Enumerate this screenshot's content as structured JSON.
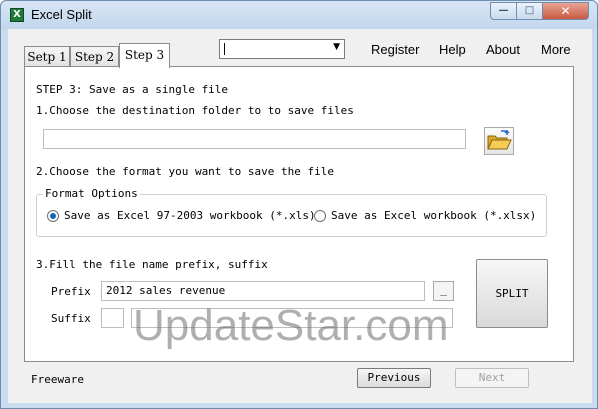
{
  "window": {
    "title": "Excel Split",
    "icon": "excel-icon",
    "controls": {
      "minimize": "minimize-icon",
      "maximize": "maximize-icon",
      "close": "close-icon"
    }
  },
  "tabs": [
    {
      "label": "Setp 1",
      "active": false
    },
    {
      "label": "Step 2",
      "active": false
    },
    {
      "label": "Step 3",
      "active": true
    }
  ],
  "dropdown": {
    "value": ""
  },
  "menu": [
    "Register",
    "Help",
    "About",
    "More"
  ],
  "step": {
    "heading": "STEP 3: Save as a single file",
    "section1": "1.Choose the destination folder to to save files",
    "folder_value": "",
    "section2": "2.Choose the format you want to save the file",
    "format_group": "Format Options",
    "format_options": [
      {
        "label": "Save as Excel 97-2003 workbook (*.xls)",
        "selected": true
      },
      {
        "label": "Save as Excel workbook (*.xlsx)",
        "selected": false
      }
    ],
    "section3": "3.Fill the file name prefix, suffix",
    "prefix_label": "Prefix",
    "prefix_value": "2012 sales revenue",
    "dash_value": "_",
    "suffix_label": "Suffix",
    "suffix_small_value": "",
    "suffix_value": "",
    "split_label": "SPLIT"
  },
  "footer": {
    "edition": "Freeware",
    "previous_label": "Previous",
    "next_label": "Next"
  },
  "watermark": "UpdateStar.com"
}
